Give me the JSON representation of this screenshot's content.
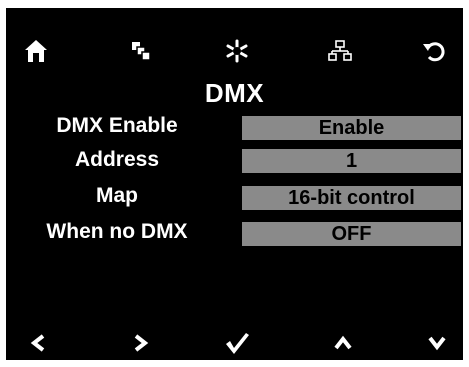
{
  "header": {
    "icons": [
      "home-icon",
      "layers-icon",
      "asterisk-icon",
      "network-icon",
      "refresh-icon"
    ]
  },
  "title": "DMX",
  "settings": [
    {
      "label": "DMX Enable",
      "value": "Enable"
    },
    {
      "label": "Address",
      "value": "1"
    },
    {
      "label": "Map",
      "value": "16-bit control"
    },
    {
      "label": "When no DMX",
      "value": "OFF"
    }
  ],
  "footer": {
    "icons": [
      "chevron-left-icon",
      "chevron-right-icon",
      "checkmark-icon",
      "chevron-up-icon",
      "chevron-down-icon"
    ]
  },
  "colors": {
    "background": "#000000",
    "text": "#ffffff",
    "value_bg": "#8a8a8a",
    "value_text": "#000000"
  }
}
